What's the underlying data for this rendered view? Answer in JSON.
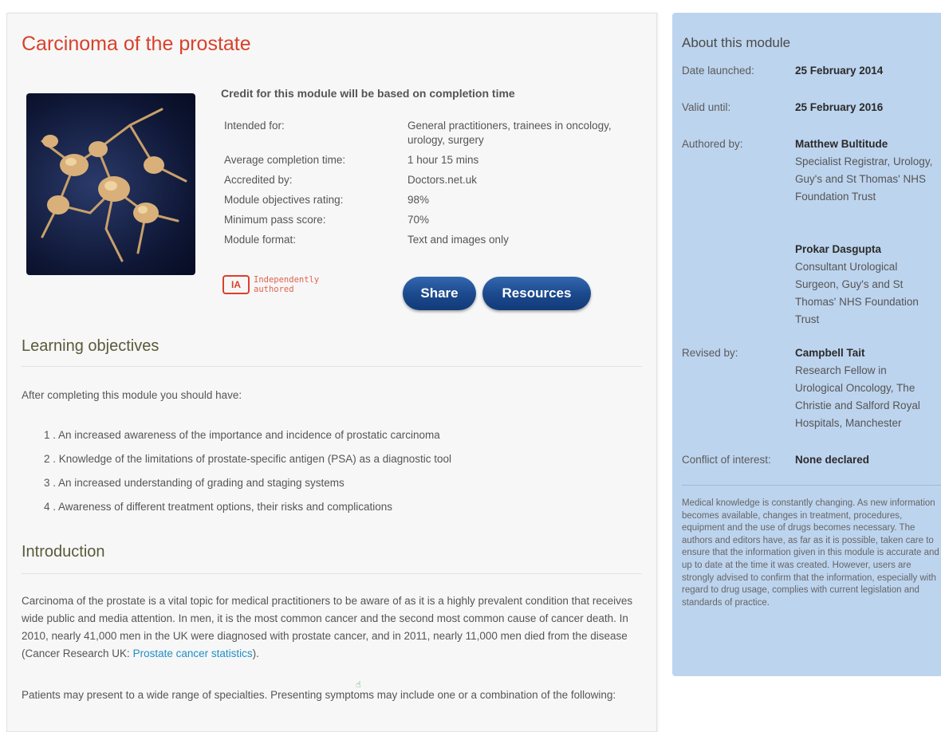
{
  "page_title": "Carcinoma of the prostate",
  "credit_note": "Credit for this module will be based on completion time",
  "meta": [
    {
      "label": "Intended for:",
      "value": "General practitioners, trainees in oncology, urology, surgery"
    },
    {
      "label": "Average completion time:",
      "value": "1 hour 15 mins"
    },
    {
      "label": "Accredited by:",
      "value": "Doctors.net.uk"
    },
    {
      "label": "Module objectives rating:",
      "value": "98%"
    },
    {
      "label": "Minimum pass score:",
      "value": "70%"
    },
    {
      "label": "Module format:",
      "value": "Text and images only"
    }
  ],
  "badge": {
    "mark": "IA",
    "line1": "Independently",
    "line2": "authored"
  },
  "buttons": {
    "share": "Share",
    "resources": "Resources"
  },
  "learning": {
    "heading": "Learning objectives",
    "intro": "After completing this module you should have:",
    "items": [
      "1 . An increased awareness of the importance and incidence of prostatic carcinoma",
      "2 . Knowledge of the limitations of prostate-specific antigen (PSA) as a diagnostic tool",
      "3 . An increased understanding of grading and staging systems",
      "4 . Awareness of different treatment options, their risks and complications"
    ]
  },
  "intro": {
    "heading": "Introduction",
    "para1_text": "Carcinoma of the prostate is a vital topic for medical practitioners to be aware of as it is a highly prevalent condition that receives wide public and media attention. In men, it is the most common cancer and the second most common cause of cancer death. In 2010, nearly 41,000 men in the UK were diagnosed with prostate cancer, and in 2011, nearly 11,000 men died from the disease (Cancer Research UK: ",
    "para1_link": "Prostate cancer statistics",
    "para1_end": ").",
    "para2": "Patients may present to a wide range of specialties. Presenting symptoms may include one or a combination of the following:"
  },
  "sidebar": {
    "title": "About this module",
    "date_launched_label": "Date launched:",
    "date_launched": "25 February 2014",
    "valid_until_label": "Valid until:",
    "valid_until": "25 February 2016",
    "authored_label": "Authored by:",
    "author1_name": "Matthew Bultitude",
    "author1_role": "Specialist Registrar, Urology, Guy's and St Thomas' NHS Foundation Trust",
    "author2_name": "Prokar Dasgupta",
    "author2_role": "Consultant Urological Surgeon, Guy's and St Thomas' NHS Foundation Trust",
    "revised_label": "Revised by:",
    "reviser_name": "Campbell Tait",
    "reviser_role": "Research Fellow in Urological Oncology, The Christie and Salford Royal Hospitals, Manchester",
    "conflict_label": "Conflict of interest:",
    "conflict_value": "None declared",
    "disclaimer": "Medical knowledge is constantly changing. As new information becomes available, changes in treatment, procedures, equipment and the use of drugs becomes necessary. The authors and editors have, as far as it is possible, taken care to ensure that the information given in this module is accurate and up to date at the time it was created. However, users are strongly advised to confirm that the information, especially with regard to drug usage, complies with current legislation and standards of practice."
  },
  "colors": {
    "title": "#d9412b",
    "button": "#1c4a8e",
    "sidebar": "#bdd4ee",
    "link": "#1f8fc7"
  }
}
